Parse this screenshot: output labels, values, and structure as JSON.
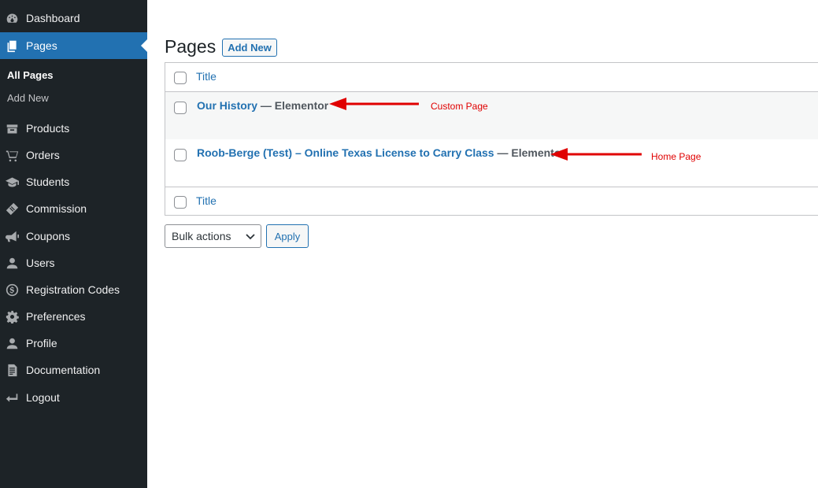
{
  "sidebar": {
    "items": [
      {
        "label": "Dashboard",
        "icon": "dashboard-icon"
      },
      {
        "label": "Pages",
        "icon": "pages-icon",
        "active": true
      },
      {
        "label": "Products",
        "icon": "products-icon"
      },
      {
        "label": "Orders",
        "icon": "cart-icon"
      },
      {
        "label": "Students",
        "icon": "graduation-cap-icon"
      },
      {
        "label": "Commission",
        "icon": "clipboard-icon"
      },
      {
        "label": "Coupons",
        "icon": "megaphone-icon"
      },
      {
        "label": "Users",
        "icon": "user-icon"
      },
      {
        "label": "Registration Codes",
        "icon": "dollar-circle-icon"
      },
      {
        "label": "Preferences",
        "icon": "gear-icon"
      },
      {
        "label": "Profile",
        "icon": "user-icon"
      },
      {
        "label": "Documentation",
        "icon": "document-icon"
      },
      {
        "label": "Logout",
        "icon": "logout-icon"
      }
    ],
    "submenu": {
      "all_pages": "All Pages",
      "add_new": "Add New"
    }
  },
  "main": {
    "title": "Pages",
    "add_new_label": "Add New",
    "column_title": "Title",
    "rows": [
      {
        "title": "Our History",
        "state": " — Elementor"
      },
      {
        "title": "Roob-Berge (Test) – Online Texas License to Carry Class",
        "state": " — Elementor"
      }
    ],
    "bulk_actions_label": "Bulk actions",
    "apply_label": "Apply"
  },
  "annotations": {
    "custom_page": "Custom Page",
    "home_page": "Home Page"
  },
  "colors": {
    "sidebar_bg": "#1d2327",
    "accent": "#2271b1",
    "annotation": "#e00000"
  }
}
